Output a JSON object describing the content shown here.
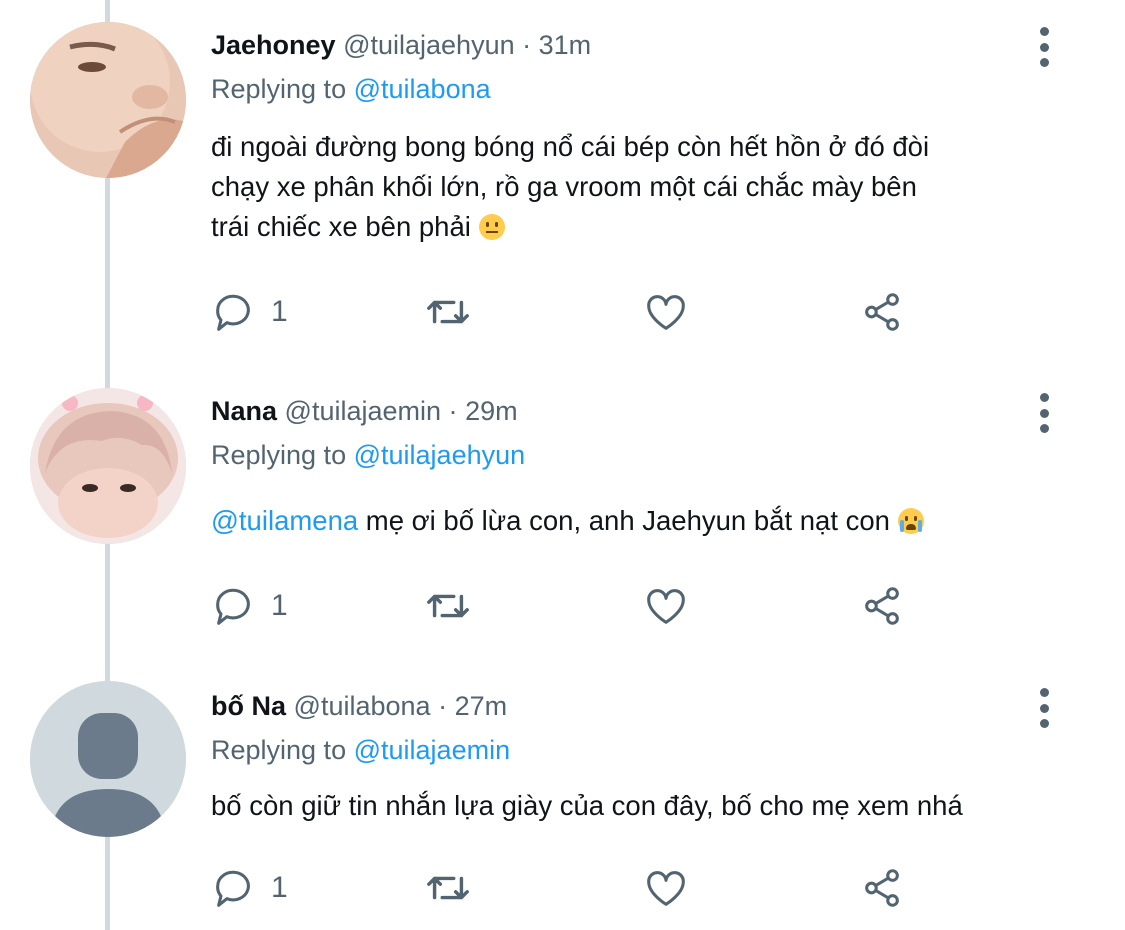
{
  "tweets": [
    {
      "display_name": "Jaehoney",
      "handle": "@tuilajaehyun",
      "separator": "·",
      "time": "31m",
      "replying_prefix": "Replying to",
      "replying_to": "@tuilabona",
      "text_line1": "đi ngoài đường bong bóng nổ cái bép còn hết hồn ở đó đòi",
      "text_line2": "chạy xe phân khối lớn, rồ ga vroom một cái chắc mày bên",
      "text_line3": "trái chiếc xe bên phải",
      "emoji": "neutral-face",
      "reply_count": "1"
    },
    {
      "display_name": "Nana",
      "handle": "@tuilajaemin",
      "separator": "·",
      "time": "29m",
      "replying_prefix": "Replying to",
      "replying_to": "@tuilajaehyun",
      "mention": "@tuilamena",
      "text": "mẹ ơi bố lừa con, anh Jaehyun bắt nạt con",
      "emoji": "loudly-crying-face",
      "reply_count": "1"
    },
    {
      "display_name": "bố Na",
      "handle": "@tuilabona",
      "separator": "·",
      "time": "27m",
      "replying_prefix": "Replying to",
      "replying_to": "@tuilajaemin",
      "text": "bố còn giữ tin nhắn lựa giày của con đây, bố cho mẹ xem nhá",
      "reply_count": "1"
    }
  ],
  "colors": {
    "text": "#0f1419",
    "secondary": "#536471",
    "link": "#1d9bf0",
    "thread_line": "#cfd9de"
  },
  "icons": [
    "reply-icon",
    "retweet-icon",
    "like-icon",
    "share-icon",
    "more-icon",
    "default-avatar-icon"
  ]
}
